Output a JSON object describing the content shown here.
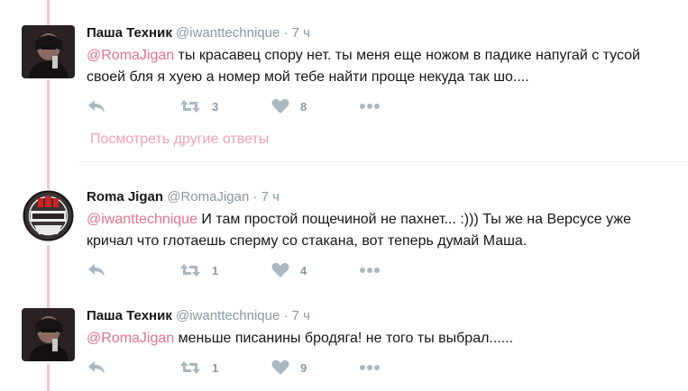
{
  "tweets": [
    {
      "name": "Паша Техник",
      "handle": "@iwanttechnique",
      "sep": "·",
      "time": "7 ч",
      "mention": "@RomaJigan",
      "text": " ты красавец спору нет. ты меня еще ножом в падике напугай с тусой своей бля я хуею а номер мой тебе найти проще некуда так шо....",
      "retweets": "3",
      "likes": "8",
      "avatar": "dark-performer-photo"
    },
    {
      "name": "Roma Jigan",
      "handle": "@RomaJigan",
      "sep": "·",
      "time": "7 ч",
      "mention": "@iwanttechnique",
      "text": " И там простой пощечиной не пахнет... :))) Ты же на Версусе уже кричал что глотаешь сперму со стакана, вот теперь думай Маша.",
      "retweets": "1",
      "likes": "4",
      "avatar": "emblem-logo"
    },
    {
      "name": "Паша Техник",
      "handle": "@iwanttechnique",
      "sep": "·",
      "time": "7 ч",
      "mention": "@RomaJigan",
      "text": " меньше писанины бродяга! не того ты выбрал......",
      "retweets": "1",
      "likes": "9",
      "avatar": "dark-performer-photo"
    }
  ],
  "more_replies": "Посмотреть другие ответы",
  "colors": {
    "mention": "#e3718d",
    "thread_line": "#f4c7cc",
    "action_icon": "#aab8c2",
    "meta_text": "#8899a6"
  }
}
